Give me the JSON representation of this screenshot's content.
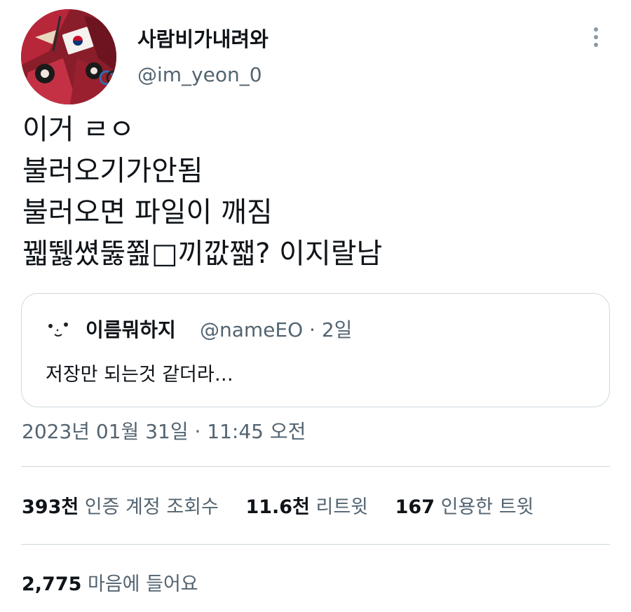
{
  "author": {
    "display_name": "사람비가내려와",
    "handle": "@im_yeon_0",
    "avatar_icon": "avatar-icon"
  },
  "tweet": {
    "lines": [
      "이거 ㄹㅇ",
      "불러오기가안됨",
      "불러오면 파일이 깨짐",
      "꿻뛣쎴뚫쬞□끼깞쨃? 이지랄남"
    ]
  },
  "quote": {
    "display_name": "이름뭐하지",
    "handle": "@nameEO",
    "separator": "·",
    "time": "2일",
    "text": "저장만 되는것 같더라…"
  },
  "timestamp": "2023년 01월 31일 · 11:45 오전",
  "stats": {
    "views_count": "393천",
    "views_label": "인증 계정 조회수",
    "retweets_count": "11.6천",
    "retweets_label": "리트윗",
    "quotes_count": "167",
    "quotes_label": "인용한 트윗"
  },
  "likes": {
    "count": "2,775",
    "label": "마음에 들어요"
  },
  "colors": {
    "text_primary": "#0f1419",
    "text_secondary": "#536471",
    "border": "#cfd9de"
  }
}
